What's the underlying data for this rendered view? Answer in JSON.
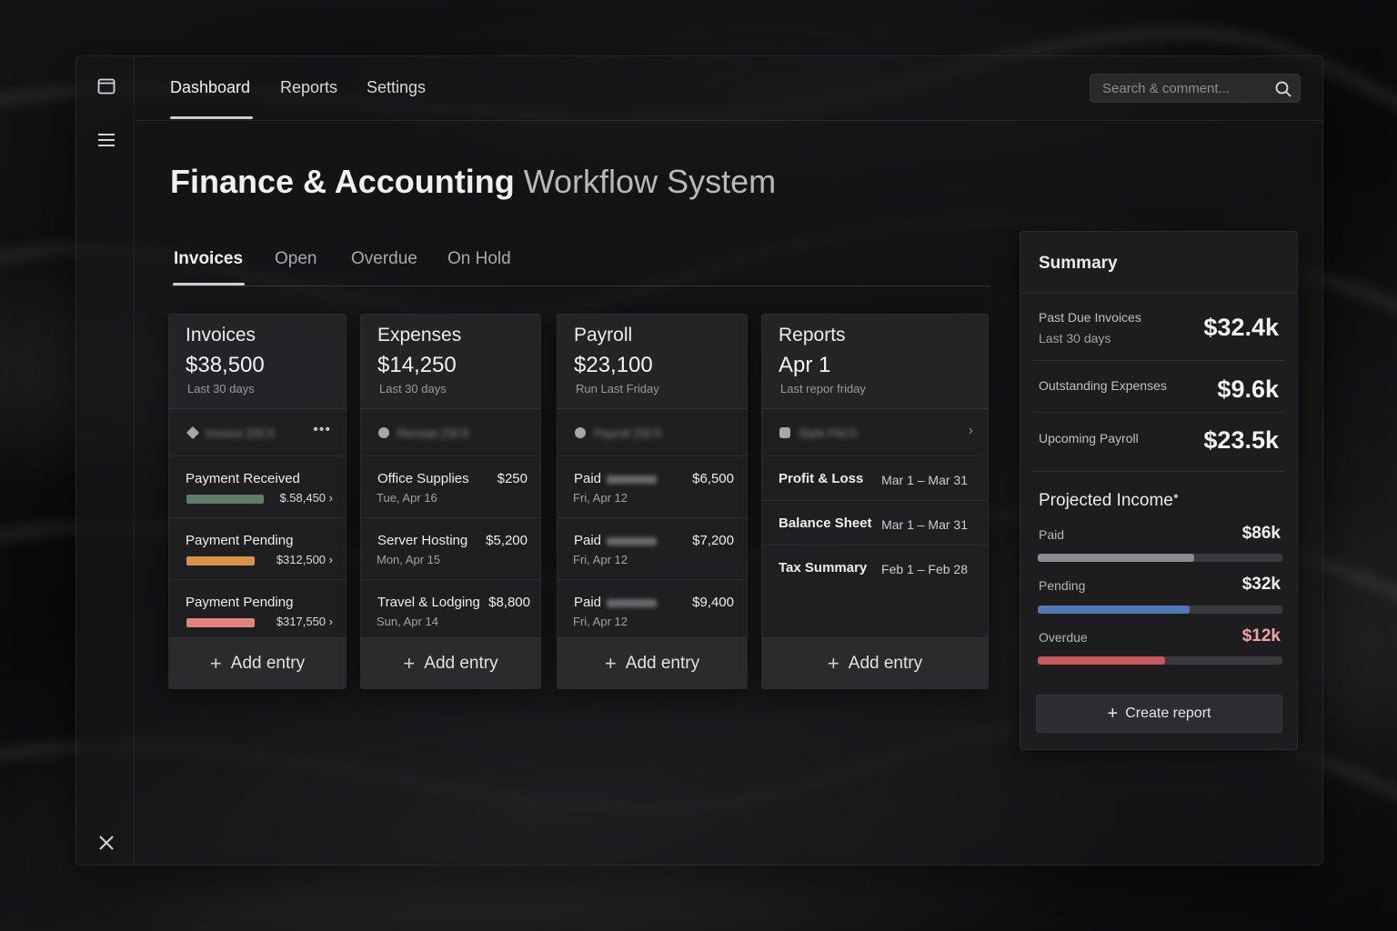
{
  "nav": {
    "tabs": [
      "Dashboard",
      "Reports",
      "Settings"
    ],
    "active": "Dashboard",
    "search_placeholder": "Search & comment..."
  },
  "page": {
    "title_strong": "Finance & Accounting",
    "title_light": "Workflow System"
  },
  "tabs": [
    "Invoices",
    "Open",
    "Overdue",
    "On Hold"
  ],
  "cards": {
    "invoices": {
      "title": "Invoices",
      "amount": "$38,500",
      "sub": "Last 30 days",
      "filter_text": "Invoice 23C5",
      "rows": [
        {
          "label": "Payment Received",
          "amount": "$.58,450",
          "bar_color": "#5f7d66",
          "bar_fraction": 0.85
        },
        {
          "label": "Payment Pending",
          "amount": "$312,500",
          "bar_color": "#d7924c",
          "bar_fraction": 0.75
        },
        {
          "label": "Payment Pending",
          "amount": "$317,550",
          "bar_color": "#e0857d",
          "bar_fraction": 0.75
        }
      ],
      "add_label": "Add entry"
    },
    "expenses": {
      "title": "Expenses",
      "amount": "$14,250",
      "sub": "Last 30 days",
      "filter_text": "Receipt 23C5",
      "rows": [
        {
          "label": "Office Supplies",
          "amount": "$250",
          "date": "Tue, Apr 16"
        },
        {
          "label": "Server Hosting",
          "amount": "$5,200",
          "date": "Mon, Apr 15"
        },
        {
          "label": "Travel & Lodging",
          "amount": "$8,800",
          "date": "Sun, Apr 14"
        }
      ],
      "add_label": "Add entry"
    },
    "payroll": {
      "title": "Payroll",
      "amount": "$23,100",
      "sub": "Run Last Friday",
      "filter_text": "Payroll 23C5",
      "rows": [
        {
          "label": "Paid",
          "amount": "$6,500",
          "date": "Fri, Apr 12"
        },
        {
          "label": "Paid",
          "amount": "$7,200",
          "date": "Fri, Apr 12"
        },
        {
          "label": "Paid",
          "amount": "$9,400",
          "date": "Fri, Apr 12"
        }
      ],
      "add_label": "Add entry"
    },
    "reports": {
      "title": "Reports",
      "amount": "Apr 1",
      "sub": "Last repor friday",
      "filter_text": "Style F6C5",
      "rows": [
        {
          "label": "Profit & Loss",
          "range": "Mar 1 – Mar 31"
        },
        {
          "label": "Balance Sheet",
          "range": "Mar 1 – Mar 31"
        },
        {
          "label": "Tax Summary",
          "range": "Feb 1 – Feb 28"
        }
      ],
      "add_label": "Add entry"
    }
  },
  "summary": {
    "title": "Summary",
    "items": [
      {
        "label": "Past Due Invoices",
        "sub": "Last 30 days",
        "value": "$32.4k"
      },
      {
        "label": "Outstanding Expenses",
        "value": "$9.6k"
      },
      {
        "label": "Upcoming Payroll",
        "value": "$23.5k"
      }
    ],
    "projected": {
      "title": "Projected Income",
      "rows": [
        {
          "label": "Paid",
          "value": "$86k",
          "fraction": 0.64,
          "color": "#8c8c94",
          "value_color": "#f0f0f0"
        },
        {
          "label": "Pending",
          "value": "$32k",
          "fraction": 0.62,
          "color": "#4f79b0",
          "value_color": "#f0f0f0"
        },
        {
          "label": "Overdue",
          "value": "$12k",
          "fraction": 0.52,
          "color": "#c9585b",
          "value_color": "#f0a3a6"
        }
      ]
    },
    "create_label": "Create report"
  }
}
